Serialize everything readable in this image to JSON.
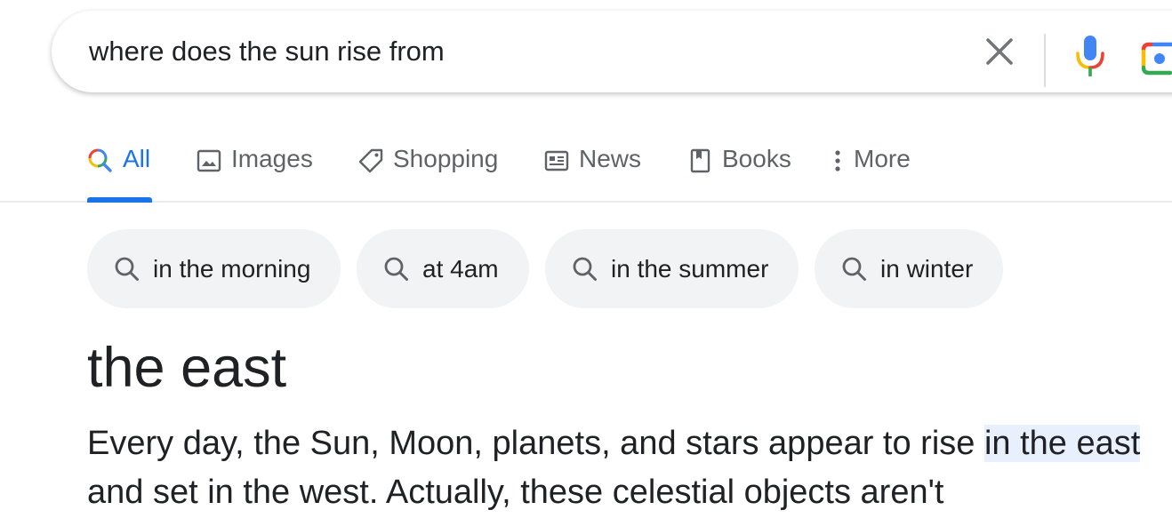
{
  "search": {
    "query": "where does the sun rise from"
  },
  "tabs": [
    {
      "label": "All",
      "icon": "search-icon",
      "active": true
    },
    {
      "label": "Images",
      "icon": "image-icon",
      "active": false
    },
    {
      "label": "Shopping",
      "icon": "tag-icon",
      "active": false
    },
    {
      "label": "News",
      "icon": "news-icon",
      "active": false
    },
    {
      "label": "Books",
      "icon": "book-icon",
      "active": false
    },
    {
      "label": "More",
      "icon": "more-vertical-icon",
      "active": false
    }
  ],
  "chips": [
    {
      "label": "in the morning",
      "icon": "search-icon"
    },
    {
      "label": "at 4am",
      "icon": "search-icon"
    },
    {
      "label": "in the summer",
      "icon": "search-icon"
    },
    {
      "label": "in winter",
      "icon": "search-icon"
    }
  ],
  "answer": {
    "title": "the east",
    "text_before": "Every day, the Sun, Moon, planets, and stars appear to rise ",
    "text_highlight": "in the east",
    "text_after": " and set in the west. Actually, these celestial objects aren't"
  },
  "colors": {
    "accent": "#1a73e8",
    "chip_bg": "#f1f3f4",
    "highlight": "#e8f0fe",
    "text": "#202124",
    "muted": "#5f6368"
  }
}
